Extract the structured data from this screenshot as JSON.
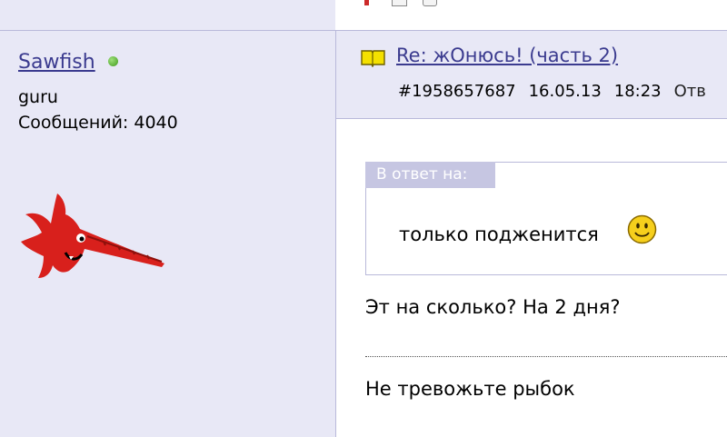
{
  "author": {
    "name": "Sawfish",
    "status": "online",
    "rank": "guru",
    "posts": "Сообщений: 4040",
    "avatar": "red-sawfish-avatar"
  },
  "post": {
    "subject": "Re: жОнюсь! (часть 2)",
    "id": "#1958657687",
    "date": "16.05.13",
    "time": "18:23",
    "reply_link": "Отв",
    "quote": {
      "label": "В ответ на:",
      "text": "только подженится",
      "emoticon": "smile-icon"
    },
    "body": "Эт на сколько? На 2 дня?",
    "signature": "Не тревожьте рыбок"
  },
  "colors": {
    "sidebar_bg": "#e8e8f6",
    "link": "#3b3b8f",
    "quote_label_bg": "#c6c6e2",
    "online_dot": "#4caf2a"
  }
}
